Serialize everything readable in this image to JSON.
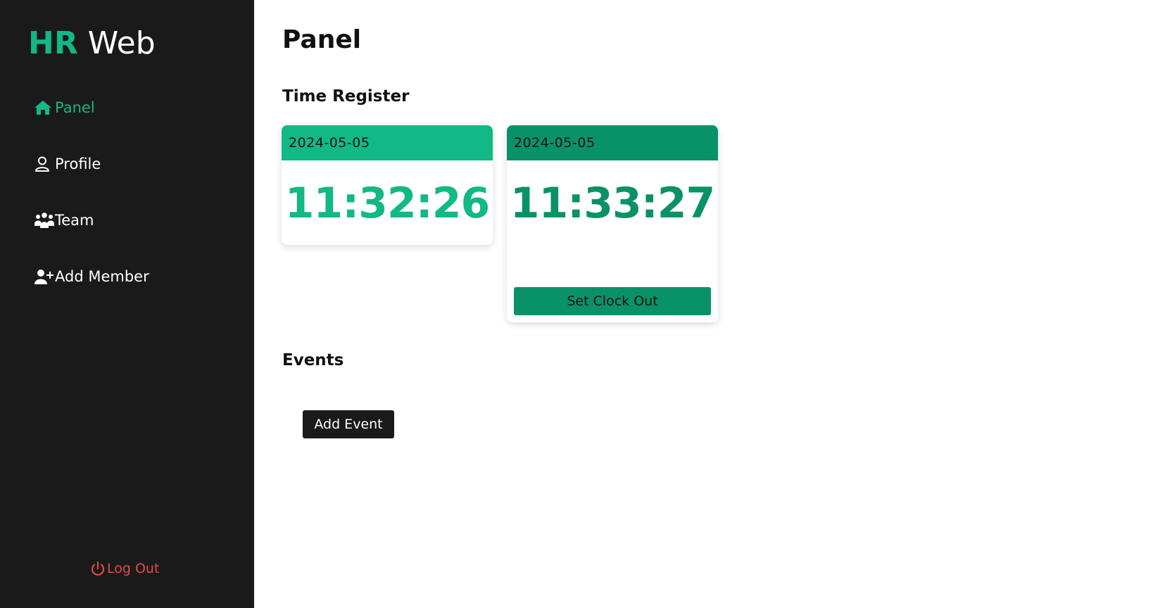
{
  "app": {
    "logo_part1": "HR",
    "logo_part2": "Web"
  },
  "sidebar": {
    "items": [
      {
        "label": "Panel",
        "icon": "home-icon",
        "active": true
      },
      {
        "label": "Profile",
        "icon": "user-icon",
        "active": false
      },
      {
        "label": "Team",
        "icon": "users-icon",
        "active": false
      },
      {
        "label": "Add Member",
        "icon": "user-plus-icon",
        "active": false
      }
    ],
    "logout_label": "Log Out",
    "logout_icon": "power-icon"
  },
  "main": {
    "title": "Panel",
    "time_register": {
      "heading": "Time Register",
      "cards": [
        {
          "date": "2024-05-05",
          "time": "11:32:26"
        },
        {
          "date": "2024-05-05",
          "time": "11:33:27",
          "button_label": "Set Clock Out"
        }
      ]
    },
    "events": {
      "heading": "Events",
      "add_button_label": "Add Event"
    }
  },
  "colors": {
    "accent": "#12b886",
    "accent_dark": "#099268",
    "sidebar_bg": "#1a1a1a",
    "logout": "#e5484d"
  }
}
